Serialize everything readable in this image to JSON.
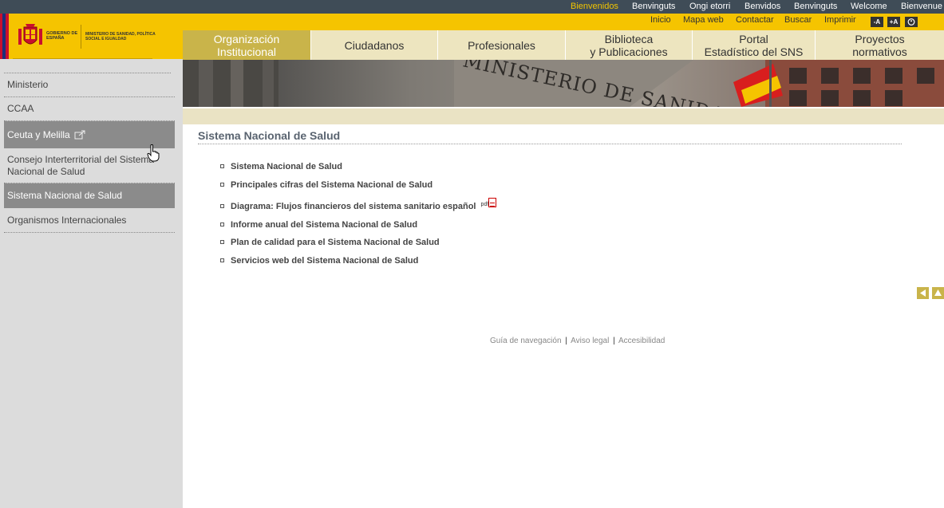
{
  "languages": [
    {
      "label": "Bienvenidos",
      "active": true
    },
    {
      "label": "Benvinguts",
      "active": false
    },
    {
      "label": "Ongi etorri",
      "active": false
    },
    {
      "label": "Benvidos",
      "active": false
    },
    {
      "label": "Benvinguts",
      "active": false
    },
    {
      "label": "Welcome",
      "active": false
    },
    {
      "label": "Bienvenue",
      "active": false
    }
  ],
  "logo": {
    "gobierno": "GOBIERNO DE ESPAÑA",
    "ministerio": "MINISTERIO DE SANIDAD, POLÍTICA SOCIAL E IGUALDAD"
  },
  "utility": {
    "links": [
      "Inicio",
      "Mapa web",
      "Contactar",
      "Buscar",
      "Imprimir"
    ],
    "size_buttons": [
      "-A",
      "+A"
    ]
  },
  "nav": {
    "tabs": [
      {
        "line1": "Organización",
        "line2": "Institucional",
        "active": true
      },
      {
        "line1": "Ciudadanos",
        "line2": "",
        "active": false
      },
      {
        "line1": "Profesionales",
        "line2": "",
        "active": false
      },
      {
        "line1": "Biblioteca",
        "line2": "y Publicaciones",
        "active": false
      },
      {
        "line1": "Portal",
        "line2": "Estadístico del SNS",
        "active": false
      },
      {
        "line1": "Proyectos",
        "line2": "normativos",
        "active": false
      }
    ]
  },
  "banner": {
    "sign_text": "MINISTERIO DE SANIDAD"
  },
  "sidebar": {
    "items": [
      {
        "label": "Ministerio",
        "highlighted": false
      },
      {
        "label": "CCAA",
        "highlighted": false
      },
      {
        "label": "Ceuta y Melilla",
        "highlighted": true,
        "icon": "external-link-icon"
      },
      {
        "label": "Consejo Interterritorial del Sistema Nacional de Salud",
        "highlighted": false
      },
      {
        "label": "Sistema Nacional de Salud",
        "highlighted": true
      },
      {
        "label": "Organismos Internacionales",
        "highlighted": false
      }
    ]
  },
  "main": {
    "title": "Sistema Nacional de Salud",
    "links": [
      {
        "label": "Sistema Nacional de Salud"
      },
      {
        "label": "Principales cifras del Sistema Nacional de Salud"
      },
      {
        "label": "Diagrama: Flujos financieros del sistema sanitario español",
        "badge": "pdf"
      },
      {
        "label": "Informe anual del Sistema Nacional de Salud"
      },
      {
        "label": "Plan de calidad para el Sistema Nacional de Salud"
      },
      {
        "label": "Servicios web del Sistema Nacional de Salud"
      }
    ]
  },
  "footer": {
    "links": [
      "Guía de navegación",
      "Aviso legal",
      "Accesibilidad"
    ],
    "separator": "|"
  },
  "colors": {
    "brand_yellow": "#f5c400",
    "top_bar": "#3f4c57",
    "active_tab": "#c9b44a",
    "sidebar_bg": "#dcdcdc"
  }
}
